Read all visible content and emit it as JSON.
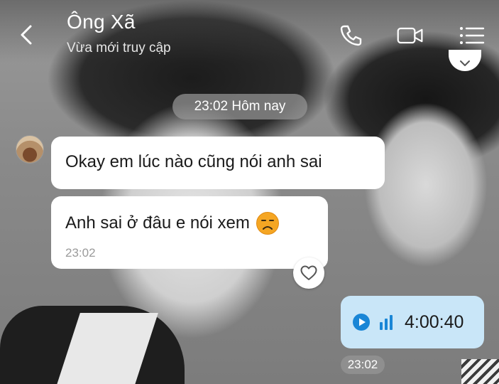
{
  "header": {
    "contact_name": "Ông Xã",
    "status": "Vừa mới truy cập"
  },
  "icons": {
    "back": "chevron-left-icon",
    "call": "phone-icon",
    "video": "video-camera-icon",
    "menu": "list-menu-icon",
    "scroll": "chevron-down-icon",
    "react": "heart-outline-icon",
    "emoji": "sad-face-emoji",
    "play": "play-icon",
    "wave": "audio-bars-icon"
  },
  "divider_time": "23:02 Hôm nay",
  "messages": [
    {
      "sender": "other",
      "text": "Okay em lúc nào cũng nói anh sai"
    },
    {
      "sender": "other",
      "text": "Anh sai ở đâu e nói xem",
      "time": "23:02"
    }
  ],
  "voice_message": {
    "duration": "4:00:40",
    "time": "23:02"
  },
  "colors": {
    "voice_bubble": "#c9e6f8",
    "voice_icon": "#1a86d6",
    "incoming_bubble": "#ffffff"
  }
}
